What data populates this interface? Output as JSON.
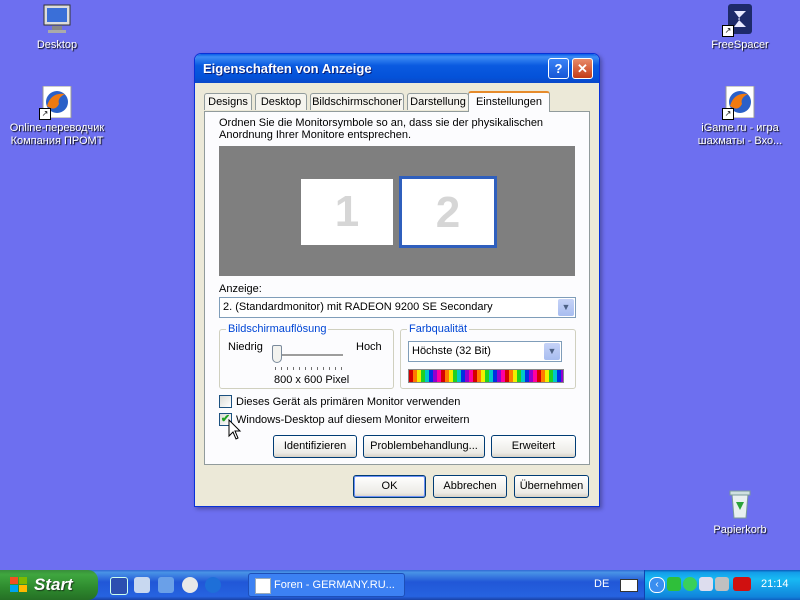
{
  "desktop": {
    "icons": [
      {
        "label": "Desktop"
      },
      {
        "label": "Online-переводчик Компания ПРОМТ"
      },
      {
        "label": "FreeSpacer"
      },
      {
        "label": "iGame.ru - игра шахматы - Вхо..."
      },
      {
        "label": "Papierkorb"
      }
    ]
  },
  "dialog": {
    "title": "Eigenschaften von Anzeige",
    "help_label": "?",
    "close_label": "✕",
    "tabs": [
      {
        "label": "Designs"
      },
      {
        "label": "Desktop"
      },
      {
        "label": "Bildschirmschoner"
      },
      {
        "label": "Darstellung"
      },
      {
        "label": "Einstellungen"
      }
    ],
    "active_tab": "Einstellungen",
    "instruction": "Ordnen Sie die Monitorsymbole so an, dass sie der physikalischen Anordnung Ihrer Monitore entsprechen.",
    "monitors": [
      {
        "number": "1"
      },
      {
        "number": "2"
      }
    ],
    "display_label": "Anzeige:",
    "display_value": "2. (Standardmonitor) mit RADEON 9200 SE Secondary",
    "resolution": {
      "legend": "Bildschirmauflösung",
      "low": "Niedrig",
      "high": "Hoch",
      "value": "800 x 600 Pixel"
    },
    "color": {
      "legend": "Farbqualität",
      "value": "Höchste (32 Bit)"
    },
    "checkbox_primary": {
      "label": "Dieses Gerät als primären Monitor verwenden",
      "checked": false
    },
    "checkbox_extend": {
      "label": "Windows-Desktop auf diesem Monitor erweitern",
      "checked": true,
      "mark": "✔"
    },
    "buttons": {
      "identify": "Identifizieren",
      "troubleshoot": "Problembehandlung...",
      "advanced": "Erweitert",
      "ok": "OK",
      "cancel": "Abbrechen",
      "apply": "Übernehmen"
    },
    "arrow_glyph": "▼"
  },
  "taskbar": {
    "start_label": "Start",
    "task_label": "Foren - GERMANY.RU...",
    "language": "DE",
    "tray_chevron": "‹",
    "clock": "21:14"
  }
}
